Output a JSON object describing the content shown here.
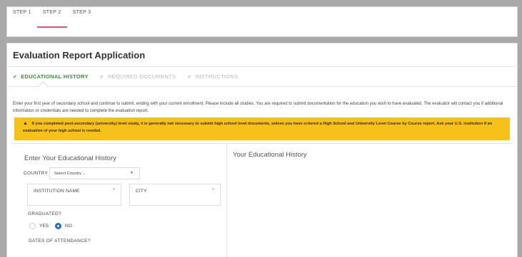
{
  "steps": [
    "STEP 1",
    "STEP 2",
    "STEP 3"
  ],
  "active_step": "STEP 2",
  "title": "Evaluation Report Application",
  "subtabs": [
    {
      "label": "EDUCATIONAL HISTORY",
      "state": "active"
    },
    {
      "label": "REQUIRED DOCUMENTS",
      "state": "inactive"
    },
    {
      "label": "INSTRUCTIONS",
      "state": "inactive"
    }
  ],
  "check_glyph": "✔",
  "intro_text": "Enter your first year of secondary school and continue to submit, ending with your current enrollment. Please include all studies. You are required to submit documentation for the education you wish to have evaluated. The evaluator will contact you if additional information or credentials are needed to complete the evaluation report.",
  "warning": {
    "icon": "warning-icon",
    "text": "If you completed post-secondary (university) level study, it is generally not necessary to submit high school level documents, unless you have ordered a High School and University Level Course by Course report. Ask your U.S. institution if an evaluation of your high school is needed."
  },
  "left_panel": {
    "title": "Enter Your Educational History",
    "country_label": "COUNTRY",
    "country_placeholder": "Select Country ...",
    "institution_label": "INSTITUTION NAME",
    "city_label": "CITY",
    "required_mark": "*",
    "graduated_label": "GRADUATED?",
    "radio_yes": "YES",
    "radio_no": "NO",
    "graduated_value": "NO",
    "dates_label": "DATES OF ATTENDANCE?"
  },
  "right_panel": {
    "title": "Your Educational History"
  },
  "colors": {
    "accent_pink": "#e8556f",
    "active_green": "#3a8f3a",
    "warning_bg": "#f6c119",
    "radio_blue": "#1f6fd1"
  }
}
